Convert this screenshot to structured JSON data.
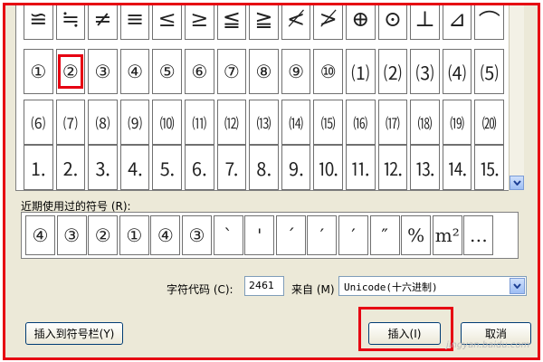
{
  "symbol_grid": {
    "rows": [
      [
        "≌",
        "≒",
        "≠",
        "≡",
        "≤",
        "≥",
        "≦",
        "≧",
        "≮",
        "≯",
        "⊕",
        "⊙",
        "⊥",
        "⊿",
        "⌒"
      ],
      [
        "①",
        "②",
        "③",
        "④",
        "⑤",
        "⑥",
        "⑦",
        "⑧",
        "⑨",
        "⑩",
        "⑴",
        "⑵",
        "⑶",
        "⑷",
        "⑸"
      ],
      [
        "⑹",
        "⑺",
        "⑻",
        "⑼",
        "⑽",
        "⑾",
        "⑿",
        "⒀",
        "⒁",
        "⒂",
        "⒃",
        "⒄",
        "⒅",
        "⒆",
        "⒇"
      ],
      [
        "⒈",
        "⒉",
        "⒊",
        "⒋",
        "⒌",
        "⒍",
        "⒎",
        "⒏",
        "⒐",
        "⒑",
        "⒒",
        "⒓",
        "⒔",
        "⒕",
        "⒖"
      ]
    ],
    "selected": {
      "row": 1,
      "col": 1
    }
  },
  "recent": {
    "label": "近期使用过的符号 (R):",
    "symbols": [
      "④",
      "③",
      "②",
      "①",
      "④",
      "③",
      "`",
      "'",
      "´",
      "′",
      "′",
      "″",
      "%",
      "m²",
      "…"
    ]
  },
  "char_code": {
    "label": "字符代码 (C):",
    "value": "2461"
  },
  "from": {
    "label": "来自 (M)",
    "value": "Unicode(十六进制)"
  },
  "buttons": {
    "insert_to_toolbar": "插入到符号栏(Y)",
    "insert": "插入(I)",
    "cancel": "取消"
  },
  "colors": {
    "highlight": "#e60012"
  },
  "watermark": "jingyan.baidu.com"
}
